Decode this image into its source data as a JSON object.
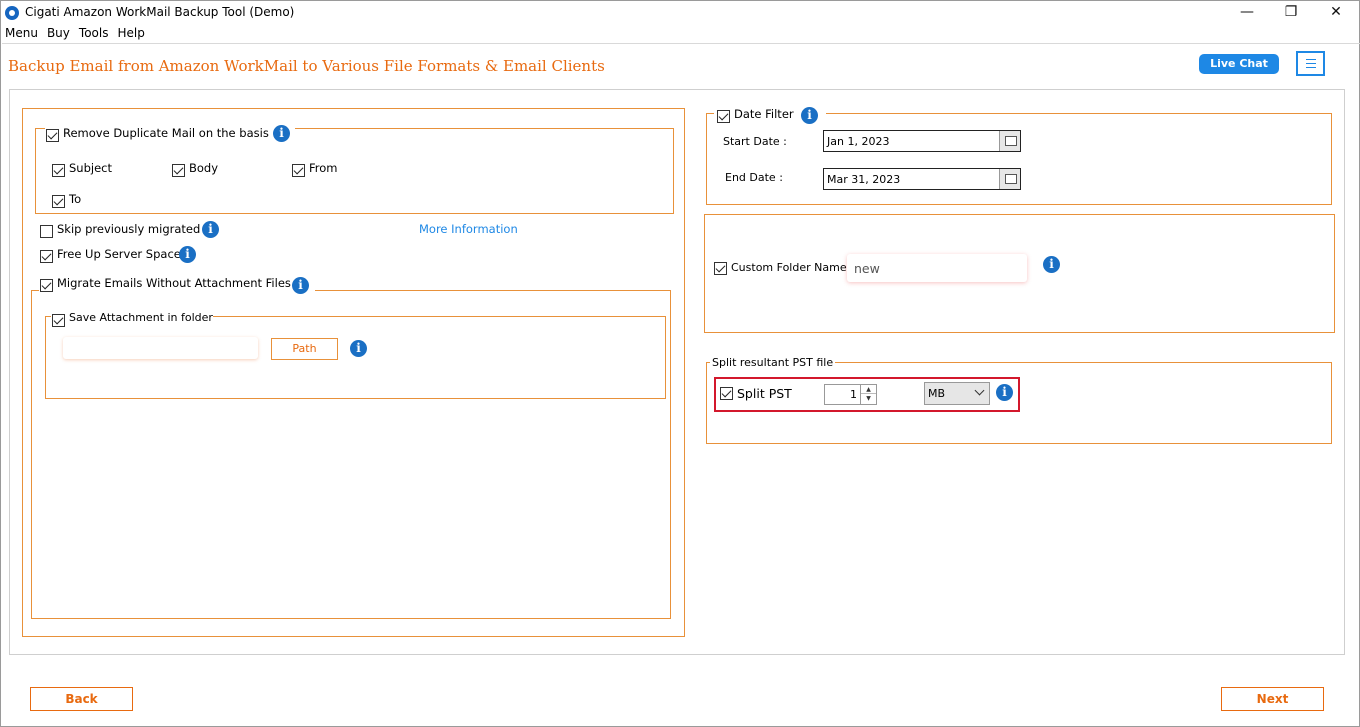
{
  "window": {
    "title": "Cigati Amazon WorkMail Backup Tool (Demo)",
    "controls": {
      "minimize": "—",
      "maximize": "❐",
      "close": "✕"
    }
  },
  "menubar": [
    "Menu",
    "Buy",
    "Tools",
    "Help"
  ],
  "header": {
    "title": "Backup Email from Amazon WorkMail to Various File Formats & Email Clients",
    "live_chat": "Live Chat"
  },
  "left": {
    "remove_duplicate": {
      "label": "Remove Duplicate Mail on the basis",
      "checked": true
    },
    "basis_options": [
      {
        "label": "Subject",
        "checked": true
      },
      {
        "label": "Body",
        "checked": true
      },
      {
        "label": "From",
        "checked": true
      },
      {
        "label": "To",
        "checked": true
      }
    ],
    "skip_migrated": {
      "label": "Skip previously migrated",
      "checked": false
    },
    "more_info": "More Information",
    "free_up": {
      "label": "Free Up Server Space",
      "checked": true
    },
    "migrate_without_attach": {
      "label": "Migrate Emails Without Attachment Files",
      "checked": true
    },
    "save_attachment": {
      "label": "Save Attachment in folder",
      "checked": true
    },
    "path_value": "",
    "path_button": "Path"
  },
  "right": {
    "date_filter": {
      "label": "Date Filter",
      "checked": true
    },
    "start_date_label": "Start Date :",
    "start_date": "Jan 1, 2023",
    "end_date_label": "End Date :",
    "end_date": "Mar 31, 2023",
    "custom_folder": {
      "label": "Custom Folder Name",
      "checked": true,
      "value": "new"
    },
    "split_group_label": "Split resultant PST file",
    "split_pst": {
      "label": "Split PST",
      "checked": true,
      "size": "1",
      "unit": "MB"
    }
  },
  "footer": {
    "back": "Back",
    "next": "Next"
  },
  "colors": {
    "accent_orange": "#e86a10",
    "accent_blue": "#1e88e5",
    "highlight_red": "#d3182c"
  }
}
